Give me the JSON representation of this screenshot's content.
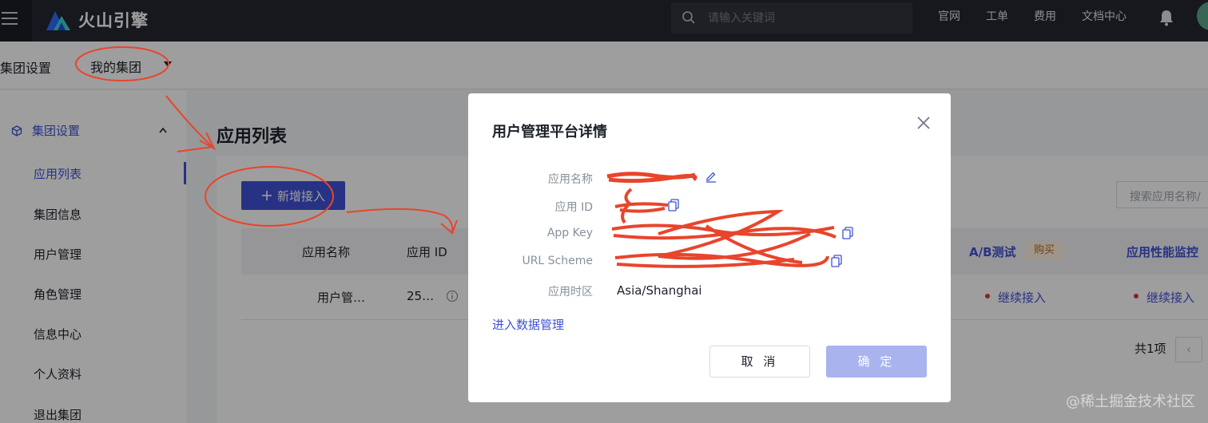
{
  "topbar": {
    "brand": "火山引擎",
    "search_placeholder": "请输入关键词",
    "nav": [
      "官网",
      "工单",
      "费用",
      "文档中心"
    ]
  },
  "subheader": {
    "title": "集团设置",
    "org_selected": "我的集团"
  },
  "sidebar": {
    "group_label": "集团设置",
    "items": [
      {
        "label": "应用列表",
        "active": true
      },
      {
        "label": "集团信息"
      },
      {
        "label": "用户管理"
      },
      {
        "label": "角色管理"
      },
      {
        "label": "信息中心"
      },
      {
        "label": "个人资料"
      },
      {
        "label": "退出集团"
      }
    ]
  },
  "main": {
    "title": "应用列表",
    "add_button": "新增接入",
    "search_placeholder": "搜索应用名称/",
    "columns": [
      "应用名称",
      "应用 ID",
      "A/B测试",
      "购买",
      "应用性能监控"
    ],
    "row": {
      "name": "用户管…",
      "id": "25…",
      "ab_status": "继续接入",
      "apm_status": "继续接入"
    },
    "pagination_total": "共1项",
    "pagination_prev": "‹"
  },
  "modal": {
    "title": "用户管理平台详情",
    "fields": [
      {
        "label": "应用名称"
      },
      {
        "label": "应用 ID"
      },
      {
        "label": "App Key"
      },
      {
        "label": "URL Scheme"
      },
      {
        "label": "应用时区",
        "value": "Asia/Shanghai"
      }
    ],
    "link": "进入数据管理",
    "cancel": "取 消",
    "confirm": "确 定"
  },
  "watermark": "@稀土掘金技术社区",
  "colors": {
    "primary": "#3f51d6",
    "topbar": "#24272f",
    "annotation": "#e8452c"
  }
}
